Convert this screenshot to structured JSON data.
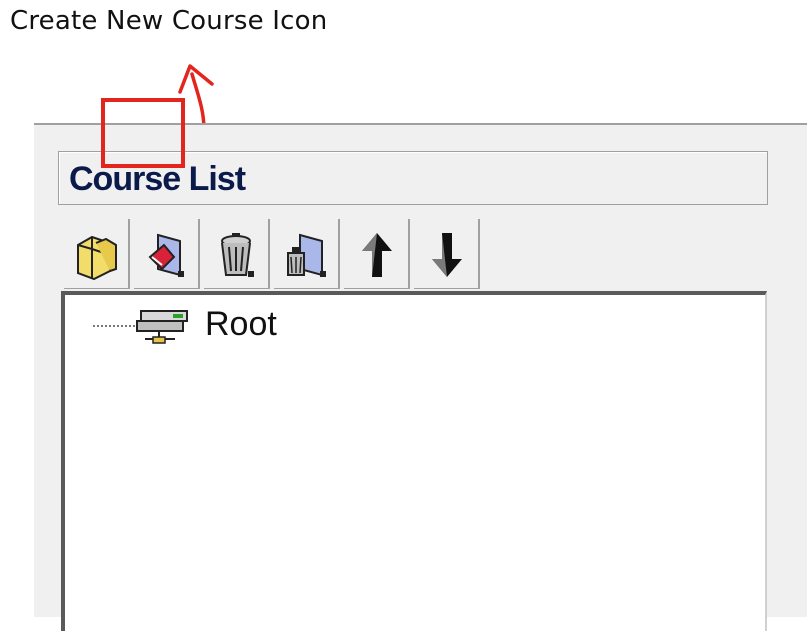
{
  "annotation": {
    "caption": "Create New Course Icon",
    "highlight_color": "#e2261d",
    "arrow_color": "#e2261d"
  },
  "panel": {
    "title": "Course List",
    "title_color": "#0a1a4a"
  },
  "toolbar": {
    "buttons": [
      {
        "name": "open-course-button",
        "icon": "package-icon"
      },
      {
        "name": "create-new-course-button",
        "icon": "new-course-icon",
        "highlighted": true
      },
      {
        "name": "delete-course-button",
        "icon": "trash-icon"
      },
      {
        "name": "properties-button",
        "icon": "document-icon"
      },
      {
        "name": "move-up-button",
        "icon": "arrow-up-icon"
      },
      {
        "name": "move-down-button",
        "icon": "arrow-down-icon"
      }
    ]
  },
  "tree": {
    "root_label": "Root",
    "root_icon": "network-server-icon"
  }
}
